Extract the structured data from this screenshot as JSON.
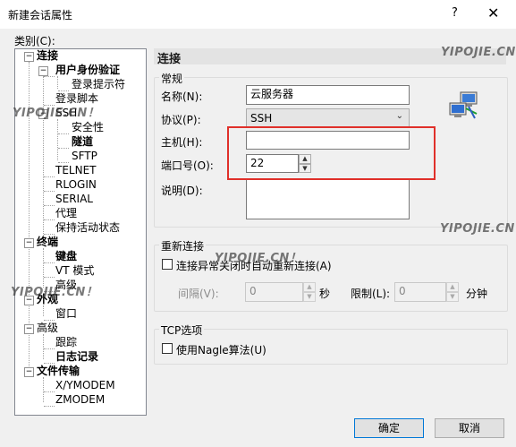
{
  "window": {
    "title": "新建会话属性",
    "help": "?",
    "close": "✕"
  },
  "category_label": "类别(C):",
  "tree": {
    "connection": "连接",
    "user_auth": "用户身份验证",
    "login_prompt": "登录提示符",
    "login_script": "登录脚本",
    "ssh": "SSH",
    "security": "安全性",
    "tunnel": "隧道",
    "sftp": "SFTP",
    "telnet": "TELNET",
    "rlogin": "RLOGIN",
    "serial": "SERIAL",
    "proxy": "代理",
    "keepalive": "保持活动状态",
    "terminal": "终端",
    "keyboard": "键盘",
    "vt_mode": "VT 模式",
    "advanced_term": "高级",
    "appearance": "外观",
    "window_node": "窗口",
    "advanced": "高级",
    "trace": "跟踪",
    "logging": "日志记录",
    "file_transfer": "文件传输",
    "xymodem": "X/YMODEM",
    "zmodem": "ZMODEM"
  },
  "panel": {
    "header": "连接",
    "general": {
      "group": "常规",
      "name_label": "名称(N):",
      "name_value": "云服务器",
      "protocol_label": "协议(P):",
      "protocol_value": "SSH",
      "host_label": "主机(H):",
      "host_value": "",
      "port_label": "端口号(O):",
      "port_value": "22",
      "desc_label": "说明(D):",
      "desc_value": ""
    },
    "reconnect": {
      "group": "重新连接",
      "checkbox_label": "连接异常关闭时自动重新连接(A)",
      "interval_label": "间隔(V):",
      "interval_value": "0",
      "sec_unit": "秒",
      "limit_label": "限制(L):",
      "limit_value": "0",
      "min_unit": "分钟"
    },
    "tcp": {
      "group": "TCP选项",
      "nagle_label": "使用Nagle算法(U)"
    }
  },
  "buttons": {
    "ok": "确定",
    "cancel": "取消"
  },
  "watermark": "YIPOJIE.CN！",
  "colors": {
    "highlight_box": "#e0302a",
    "default_button_border": "#0078d7"
  }
}
